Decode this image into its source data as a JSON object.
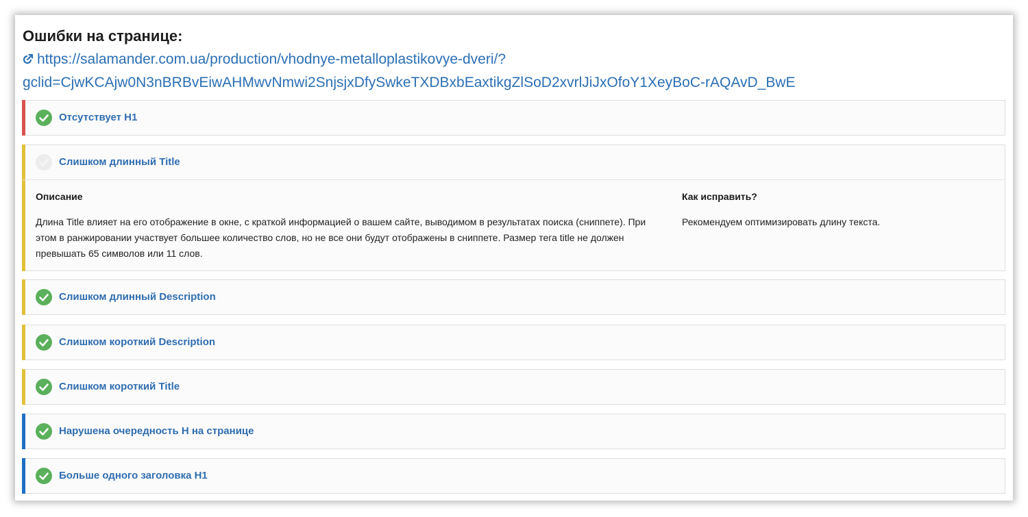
{
  "header": {
    "title": "Ошибки на странице:",
    "url_line1": "https://salamander.com.ua/production/vhodnye-metalloplastikovye-dveri/?",
    "url_line2": "gclid=CjwKCAjw0N3nBRBvEiwAHMwvNmwi2SnjsjxDfySwkeTXDBxbEaxtikgZlSoD2xvrlJiJxOfoY1XeyBoC-rAQAvD_BwE",
    "icon": "external-link-icon"
  },
  "colors": {
    "red": "#d9534f",
    "yellow": "#e2c13a",
    "blue": "#1f6fc1",
    "check_green": "#5bb05b",
    "link": "#2b6fb4"
  },
  "issues": [
    {
      "title": "Отсутствует H1",
      "severity": "red",
      "icon": "check-circle-icon"
    },
    {
      "title": "Слишком длинный Title",
      "severity": "yellow",
      "icon": "check-circle-icon",
      "expanded": true,
      "description_label": "Описание",
      "description_text": "Длина Title влияет на его отображение в окне, с краткой информацией о вашем сайте, выводимом в результатах поиска (сниппете). При этом в ранжировании участвует большее количество слов, но не все они будут отображены в сниппете. Размер тега title не должен превышать 65 символов или 11 слов.",
      "fix_label": "Как исправить?",
      "fix_text": "Рекомендуем оптимизировать длину текста."
    },
    {
      "title": "Слишком длинный Description",
      "severity": "yellow",
      "icon": "check-circle-icon"
    },
    {
      "title": "Слишком короткий Description",
      "severity": "yellow",
      "icon": "check-circle-icon"
    },
    {
      "title": "Слишком короткий Title",
      "severity": "yellow",
      "icon": "check-circle-icon"
    },
    {
      "title": "Нарушена очередность H на странице",
      "severity": "blue",
      "icon": "check-circle-icon"
    },
    {
      "title": "Больше одного заголовка H1",
      "severity": "blue",
      "icon": "check-circle-icon"
    }
  ]
}
